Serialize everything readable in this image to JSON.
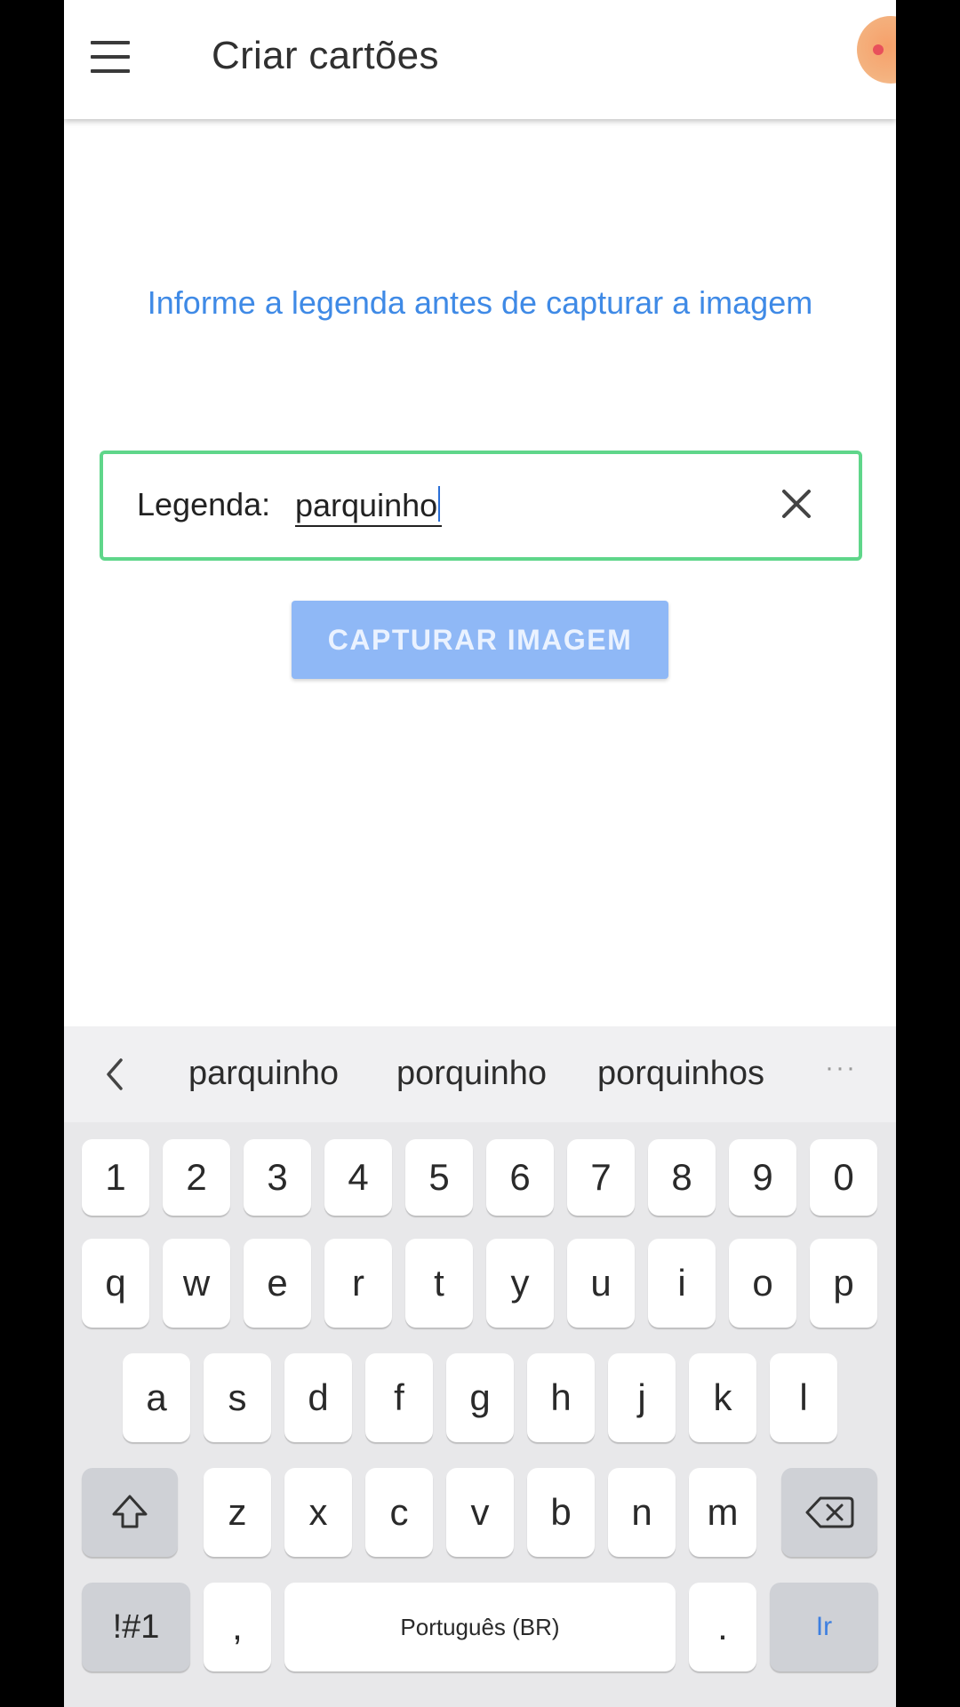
{
  "app_bar": {
    "title": "Criar cartões",
    "menu_icon": "hamburger-menu-icon",
    "avatar_color": "#f4b27f"
  },
  "main": {
    "hint": "Informe a legenda antes de capturar a imagem",
    "caption_field": {
      "label": "Legenda:",
      "value": "parquinho",
      "clear_icon": "close-icon",
      "border_color": "#5fd68a"
    },
    "capture_button": {
      "label": "CAPTURAR IMAGEM",
      "color": "#8fb8f6"
    },
    "hint_color": "#3f8ae6"
  },
  "keyboard": {
    "suggestions": [
      "parquinho",
      "porquinho",
      "porquinhos"
    ],
    "more_label": "···",
    "number_row": [
      "1",
      "2",
      "3",
      "4",
      "5",
      "6",
      "7",
      "8",
      "9",
      "0"
    ],
    "row1": [
      "q",
      "w",
      "e",
      "r",
      "t",
      "y",
      "u",
      "i",
      "o",
      "p"
    ],
    "row2": [
      "a",
      "s",
      "d",
      "f",
      "g",
      "h",
      "j",
      "k",
      "l"
    ],
    "row3": [
      "z",
      "x",
      "c",
      "v",
      "b",
      "n",
      "m"
    ],
    "symbols_label": "!#1",
    "comma_label": ",",
    "space_label": "Português (BR)",
    "period_label": ".",
    "go_label": "Ir",
    "go_color": "#3d7fe0"
  }
}
